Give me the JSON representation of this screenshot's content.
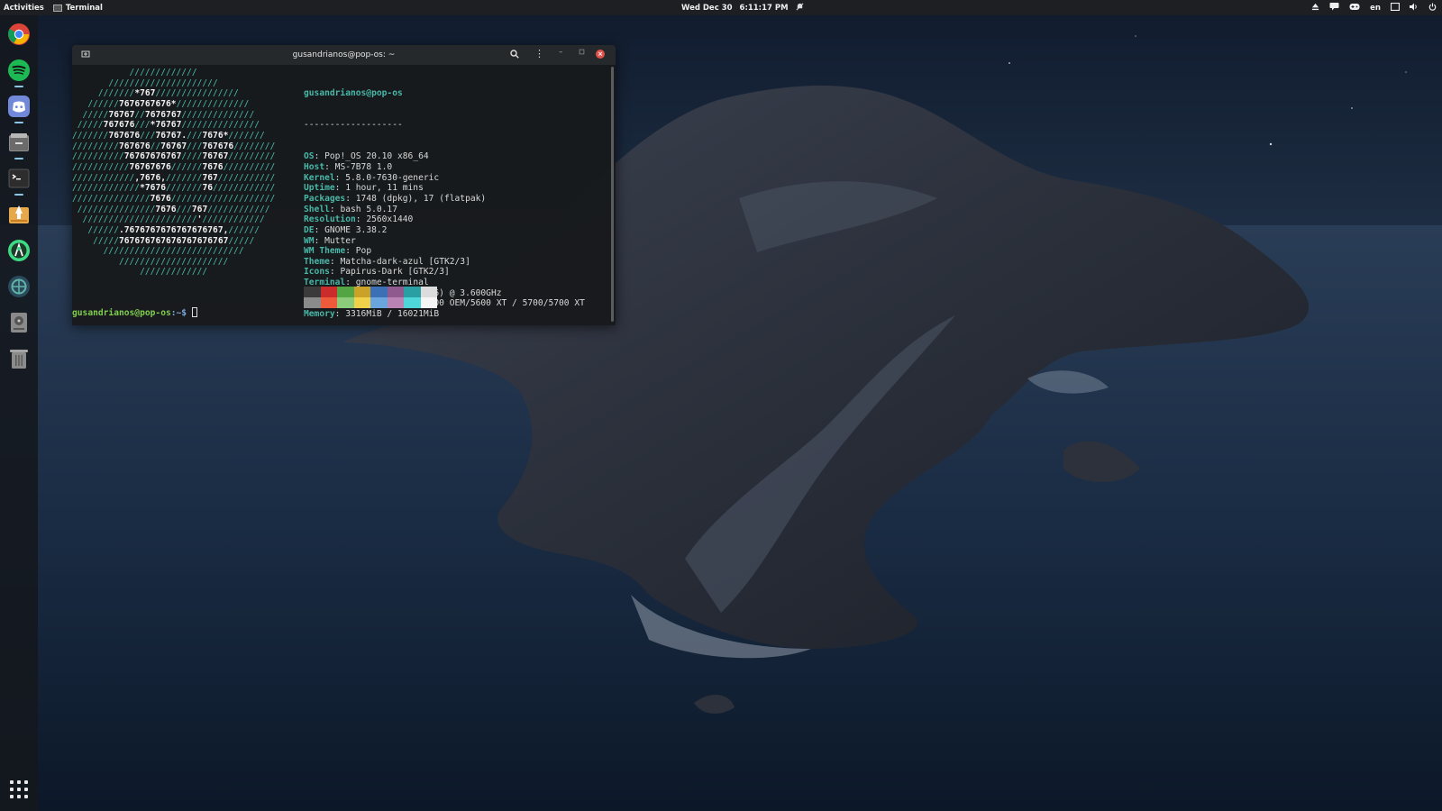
{
  "topbar": {
    "activities": "Activities",
    "app_name": "Terminal",
    "clock_date": "Wed Dec 30",
    "clock_time": "6:11:17 PM",
    "language": "en",
    "tray_icons": [
      "eject-icon",
      "chat-icon",
      "controller-icon",
      "language-indicator",
      "screen-icon",
      "volume-icon",
      "power-icon"
    ]
  },
  "dock": {
    "items": [
      {
        "name": "chrome-icon",
        "running": false
      },
      {
        "name": "spotify-icon",
        "running": true
      },
      {
        "name": "discord-icon",
        "running": true
      },
      {
        "name": "files-icon",
        "running": true
      },
      {
        "name": "terminal-icon",
        "running": true
      },
      {
        "name": "installer-icon",
        "running": false
      },
      {
        "name": "android-studio-icon",
        "running": false
      },
      {
        "name": "keybase-icon",
        "running": false
      },
      {
        "name": "disks-icon",
        "running": false
      },
      {
        "name": "trash-icon",
        "running": false
      }
    ],
    "apps_grid": "show-applications-icon"
  },
  "terminal": {
    "title": "gusandrianos@pop-os: ~",
    "logo_lines": [
      "           /////////////",
      "       /////////////////////",
      "     ///////*767////////////////",
      "   //////7676767676*//////////////",
      "  /////76767//7676767//////////////",
      " /////767676///*76767///////////////",
      "///////767676///76767.///7676*///////",
      "/////////767676//76767///767676////////",
      "//////////76767676767////76767/////////",
      "///////////76767676//////7676//////////",
      "////////////,7676,///////767///////////",
      "/////////////*7676///////76////////////",
      "///////////////7676////////////////////",
      " ///////////////7676///767////////////",
      "  //////////////////////'////////////",
      "   //////.7676767676767676767,//////",
      "    /////767676767676767676767/////",
      "      ///////////////////////////",
      "         /////////////////////",
      "             /////////////"
    ],
    "user_host": "gusandrianos@pop-os",
    "separator": "-------------------",
    "info": [
      {
        "key": "OS",
        "value": "Pop!_OS 20.10 x86_64"
      },
      {
        "key": "Host",
        "value": "MS-7B78 1.0"
      },
      {
        "key": "Kernel",
        "value": "5.8.0-7630-generic"
      },
      {
        "key": "Uptime",
        "value": "1 hour, 11 mins"
      },
      {
        "key": "Packages",
        "value": "1748 (dpkg), 17 (flatpak)"
      },
      {
        "key": "Shell",
        "value": "bash 5.0.17"
      },
      {
        "key": "Resolution",
        "value": "2560x1440"
      },
      {
        "key": "DE",
        "value": "GNOME 3.38.2"
      },
      {
        "key": "WM",
        "value": "Mutter"
      },
      {
        "key": "WM Theme",
        "value": "Pop"
      },
      {
        "key": "Theme",
        "value": "Matcha-dark-azul [GTK2/3]"
      },
      {
        "key": "Icons",
        "value": "Papirus-Dark [GTK2/3]"
      },
      {
        "key": "Terminal",
        "value": "gnome-terminal"
      },
      {
        "key": "CPU",
        "value": "AMD Ryzen 7 3700X (16) @ 3.600GHz"
      },
      {
        "key": "GPU",
        "value": "AMD ATI Radeon RX 5600 OEM/5600 XT / 5700/5700 XT"
      },
      {
        "key": "Memory",
        "value": "3316MiB / 16021MiB"
      }
    ],
    "palette_row1": [
      "#3a3a3a",
      "#cc2b2b",
      "#53a543",
      "#c9a227",
      "#3b6fb6",
      "#8f5b8f",
      "#2a9fa3",
      "#dcdcdc"
    ],
    "palette_row2": [
      "#8a8a8a",
      "#ef5a3a",
      "#8ccb7a",
      "#f1d04a",
      "#6aa6dd",
      "#b983b3",
      "#4fd6d9",
      "#f5f5f5"
    ],
    "prompt_user": "gusandrianos@pop-os",
    "prompt_path": ":~$ "
  }
}
